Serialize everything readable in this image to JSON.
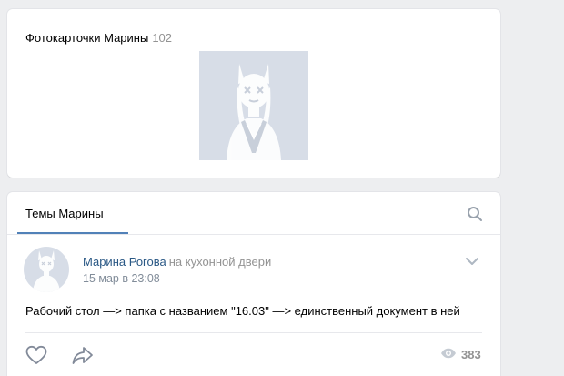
{
  "photos": {
    "title": "Фотокарточки Марины",
    "count": "102",
    "thumbnail_icon": "avatar-illustration-icon"
  },
  "topics": {
    "tab_label": "Темы Марины",
    "search_icon": "search-icon",
    "post": {
      "author": "Марина Рогова",
      "context": "на кухонной двери",
      "date": "15 мар в 23:08",
      "text": "Рабочий стол —> папка с названием \"16.03\" —> единственный документ в ней",
      "views": "383",
      "menu_icon": "chevron-down-icon",
      "like_icon": "heart-icon",
      "share_icon": "share-arrow-icon",
      "views_icon": "eye-icon"
    }
  },
  "colors": {
    "background": "#edeef0",
    "link": "#2a5885",
    "accent": "#5181b8",
    "muted": "#939393"
  }
}
